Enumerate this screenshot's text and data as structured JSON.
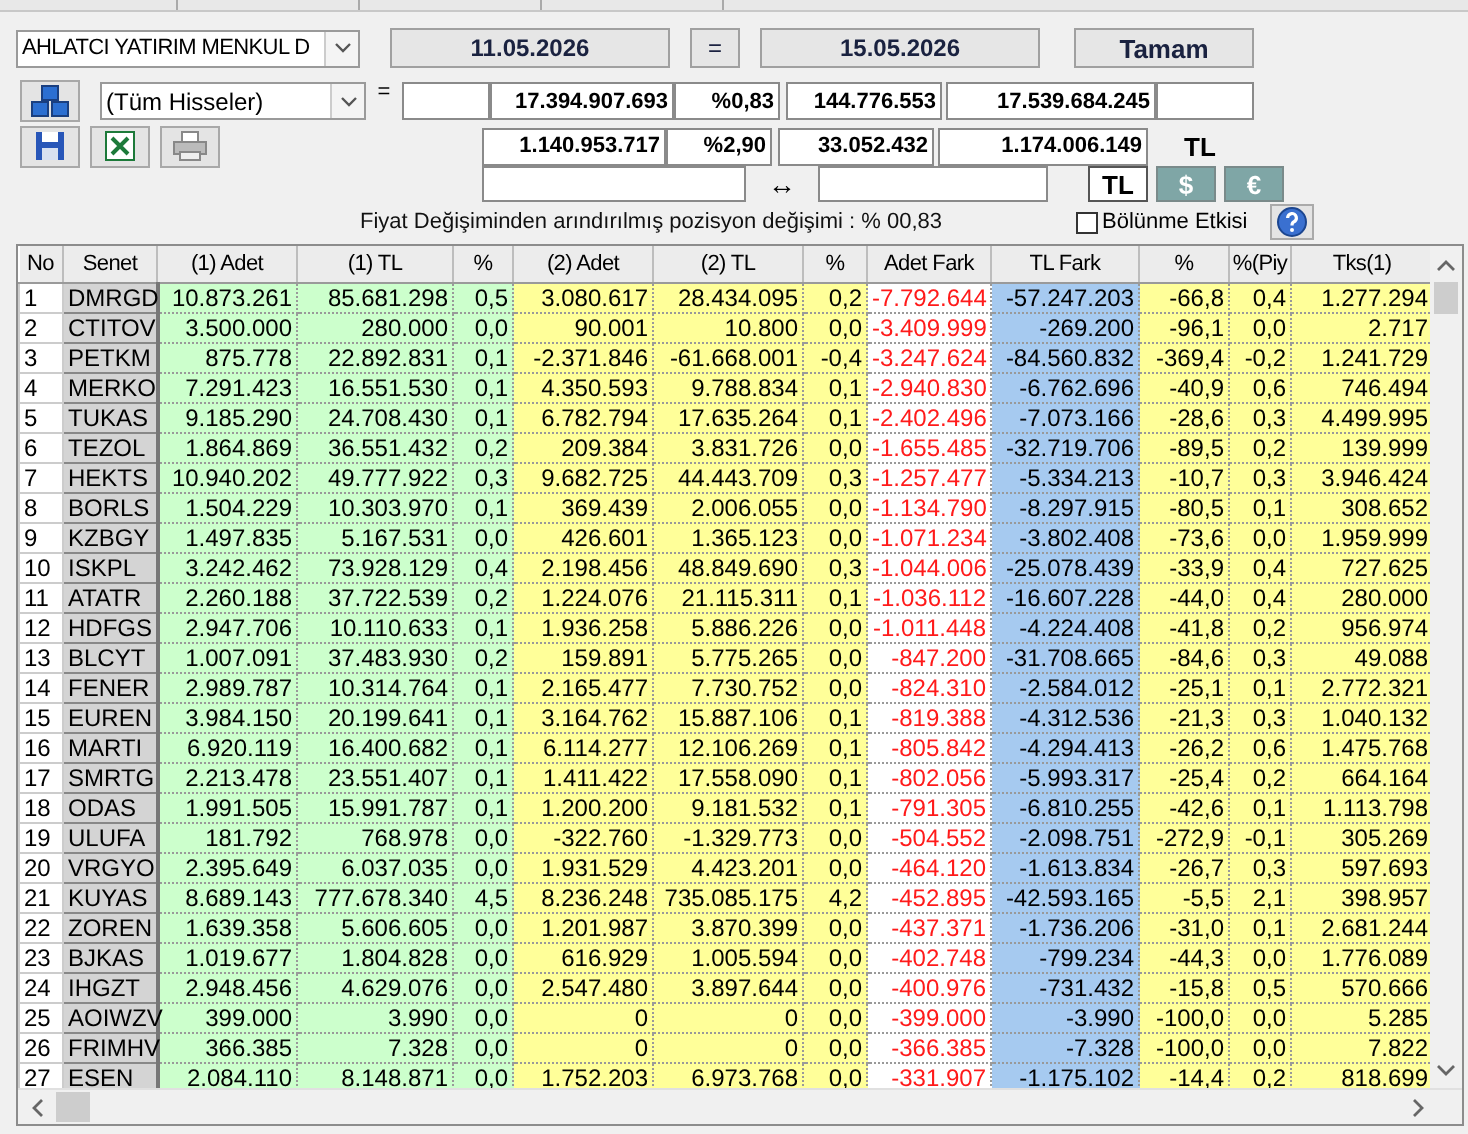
{
  "header": {
    "broker": "AHLATCI YATIRIM MENKUL D",
    "date_from": "11.05.2026",
    "equals": "=",
    "date_to": "15.05.2026",
    "ok_button": "Tamam"
  },
  "filter": {
    "stock_filter": "(Tüm Hisseler)",
    "equals": "="
  },
  "totals": [
    {
      "kind": "padded",
      "values": [
        "17.394.907.693",
        "%0,83",
        "144.776.553",
        "17.539.684.245"
      ]
    },
    {
      "kind": "plain",
      "values": [
        "1.140.953.717",
        "%2,90",
        "33.052.432",
        "1.174.006.149"
      ],
      "unit": "TL"
    }
  ],
  "range": {
    "arrow": "↔"
  },
  "currencies": [
    {
      "label": "TL",
      "selected": true
    },
    {
      "label": "$",
      "selected": false
    },
    {
      "label": "€",
      "selected": false
    }
  ],
  "summary": "Fiyat Değişiminden arındırılmış pozisyon değişimi : % 00,83",
  "split_effect": {
    "label": "Bölünme Etkisi",
    "checked": false
  },
  "table": {
    "columns": [
      {
        "label": "No",
        "kind": "index",
        "color": "#ffffff"
      },
      {
        "label": "Senet",
        "kind": "ticker",
        "color": "#d4d4d4"
      },
      {
        "label": "(1) Adet",
        "kind": "number",
        "color": "#ccffcc"
      },
      {
        "label": "(1) TL",
        "kind": "number",
        "color": "#ccffcc"
      },
      {
        "label": "%",
        "kind": "number",
        "color": "#ccffcc"
      },
      {
        "label": "(2) Adet",
        "kind": "number",
        "color": "#ffff99"
      },
      {
        "label": "(2) TL",
        "kind": "number",
        "color": "#ffff99"
      },
      {
        "label": "%",
        "kind": "number",
        "color": "#ffff99"
      },
      {
        "label": "Adet Fark",
        "kind": "diff",
        "color": "#ffffff"
      },
      {
        "label": "TL Fark",
        "kind": "number",
        "color": "#a6caf0"
      },
      {
        "label": "%",
        "kind": "number",
        "color": "#ffff99"
      },
      {
        "label": "%(Piy",
        "kind": "number",
        "color": "#ffff99"
      },
      {
        "label": "Tks(1)",
        "kind": "number",
        "color": "#ffff99"
      }
    ],
    "rows": [
      [
        "1",
        "DMRGD",
        "10.873.261",
        "85.681.298",
        "0,5",
        "3.080.617",
        "28.434.095",
        "0,2",
        "-7.792.644",
        "-57.247.203",
        "-66,8",
        "0,4",
        "1.277.294"
      ],
      [
        "2",
        "CTITOV",
        "3.500.000",
        "280.000",
        "0,0",
        "90.001",
        "10.800",
        "0,0",
        "-3.409.999",
        "-269.200",
        "-96,1",
        "0,0",
        "2.717"
      ],
      [
        "3",
        "PETKM",
        "875.778",
        "22.892.831",
        "0,1",
        "-2.371.846",
        "-61.668.001",
        "-0,4",
        "-3.247.624",
        "-84.560.832",
        "-369,4",
        "-0,2",
        "1.241.729"
      ],
      [
        "4",
        "MERKO",
        "7.291.423",
        "16.551.530",
        "0,1",
        "4.350.593",
        "9.788.834",
        "0,1",
        "-2.940.830",
        "-6.762.696",
        "-40,9",
        "0,6",
        "746.494"
      ],
      [
        "5",
        "TUKAS",
        "9.185.290",
        "24.708.430",
        "0,1",
        "6.782.794",
        "17.635.264",
        "0,1",
        "-2.402.496",
        "-7.073.166",
        "-28,6",
        "0,3",
        "4.499.995"
      ],
      [
        "6",
        "TEZOL",
        "1.864.869",
        "36.551.432",
        "0,2",
        "209.384",
        "3.831.726",
        "0,0",
        "-1.655.485",
        "-32.719.706",
        "-89,5",
        "0,2",
        "139.999"
      ],
      [
        "7",
        "HEKTS",
        "10.940.202",
        "49.777.922",
        "0,3",
        "9.682.725",
        "44.443.709",
        "0,3",
        "-1.257.477",
        "-5.334.213",
        "-10,7",
        "0,3",
        "3.946.424"
      ],
      [
        "8",
        "BORLS",
        "1.504.229",
        "10.303.970",
        "0,1",
        "369.439",
        "2.006.055",
        "0,0",
        "-1.134.790",
        "-8.297.915",
        "-80,5",
        "0,1",
        "308.652"
      ],
      [
        "9",
        "KZBGY",
        "1.497.835",
        "5.167.531",
        "0,0",
        "426.601",
        "1.365.123",
        "0,0",
        "-1.071.234",
        "-3.802.408",
        "-73,6",
        "0,0",
        "1.959.999"
      ],
      [
        "10",
        "ISKPL",
        "3.242.462",
        "73.928.129",
        "0,4",
        "2.198.456",
        "48.849.690",
        "0,3",
        "-1.044.006",
        "-25.078.439",
        "-33,9",
        "0,4",
        "727.625"
      ],
      [
        "11",
        "ATATR",
        "2.260.188",
        "37.722.539",
        "0,2",
        "1.224.076",
        "21.115.311",
        "0,1",
        "-1.036.112",
        "-16.607.228",
        "-44,0",
        "0,4",
        "280.000"
      ],
      [
        "12",
        "HDFGS",
        "2.947.706",
        "10.110.633",
        "0,1",
        "1.936.258",
        "5.886.226",
        "0,0",
        "-1.011.448",
        "-4.224.408",
        "-41,8",
        "0,2",
        "956.974"
      ],
      [
        "13",
        "BLCYT",
        "1.007.091",
        "37.483.930",
        "0,2",
        "159.891",
        "5.775.265",
        "0,0",
        "-847.200",
        "-31.708.665",
        "-84,6",
        "0,3",
        "49.088"
      ],
      [
        "14",
        "FENER",
        "2.989.787",
        "10.314.764",
        "0,1",
        "2.165.477",
        "7.730.752",
        "0,0",
        "-824.310",
        "-2.584.012",
        "-25,1",
        "0,1",
        "2.772.321"
      ],
      [
        "15",
        "EUREN",
        "3.984.150",
        "20.199.641",
        "0,1",
        "3.164.762",
        "15.887.106",
        "0,1",
        "-819.388",
        "-4.312.536",
        "-21,3",
        "0,3",
        "1.040.132"
      ],
      [
        "16",
        "MARTI",
        "6.920.119",
        "16.400.682",
        "0,1",
        "6.114.277",
        "12.106.269",
        "0,1",
        "-805.842",
        "-4.294.413",
        "-26,2",
        "0,6",
        "1.475.768"
      ],
      [
        "17",
        "SMRTG",
        "2.213.478",
        "23.551.407",
        "0,1",
        "1.411.422",
        "17.558.090",
        "0,1",
        "-802.056",
        "-5.993.317",
        "-25,4",
        "0,2",
        "664.164"
      ],
      [
        "18",
        "ODAS",
        "1.991.505",
        "15.991.787",
        "0,1",
        "1.200.200",
        "9.181.532",
        "0,1",
        "-791.305",
        "-6.810.255",
        "-42,6",
        "0,1",
        "1.113.798"
      ],
      [
        "19",
        "ULUFA",
        "181.792",
        "768.978",
        "0,0",
        "-322.760",
        "-1.329.773",
        "0,0",
        "-504.552",
        "-2.098.751",
        "-272,9",
        "-0,1",
        "305.269"
      ],
      [
        "20",
        "VRGYO",
        "2.395.649",
        "6.037.035",
        "0,0",
        "1.931.529",
        "4.423.201",
        "0,0",
        "-464.120",
        "-1.613.834",
        "-26,7",
        "0,3",
        "597.693"
      ],
      [
        "21",
        "KUYAS",
        "8.689.143",
        "777.678.340",
        "4,5",
        "8.236.248",
        "735.085.175",
        "4,2",
        "-452.895",
        "-42.593.165",
        "-5,5",
        "2,1",
        "398.957"
      ],
      [
        "22",
        "ZOREN",
        "1.639.358",
        "5.606.605",
        "0,0",
        "1.201.987",
        "3.870.399",
        "0,0",
        "-437.371",
        "-1.736.206",
        "-31,0",
        "0,1",
        "2.681.244"
      ],
      [
        "23",
        "BJKAS",
        "1.019.677",
        "1.804.828",
        "0,0",
        "616.929",
        "1.005.594",
        "0,0",
        "-402.748",
        "-799.234",
        "-44,3",
        "0,0",
        "1.776.089"
      ],
      [
        "24",
        "IHGZT",
        "2.948.456",
        "4.629.076",
        "0,0",
        "2.547.480",
        "3.897.644",
        "0,0",
        "-400.976",
        "-731.432",
        "-15,8",
        "0,5",
        "570.666"
      ],
      [
        "25",
        "AOIWZV",
        "399.000",
        "3.990",
        "0,0",
        "0",
        "0",
        "0,0",
        "-399.000",
        "-3.990",
        "-100,0",
        "0,0",
        "5.285"
      ],
      [
        "26",
        "FRIMHV",
        "366.385",
        "7.328",
        "0,0",
        "0",
        "0",
        "0,0",
        "-366.385",
        "-7.328",
        "-100,0",
        "0,0",
        "7.822"
      ],
      [
        "27",
        "ESEN",
        "2.084.110",
        "8.148.871",
        "0,0",
        "1.752.203",
        "6.973.768",
        "0,0",
        "-331.907",
        "-1.175.102",
        "-14,4",
        "0,2",
        "818.699"
      ]
    ]
  }
}
